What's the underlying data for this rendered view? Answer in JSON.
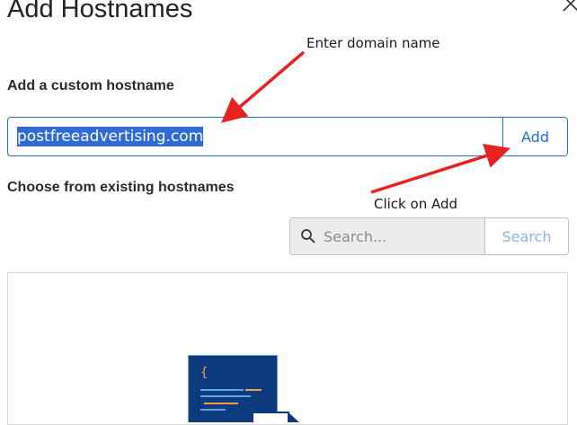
{
  "dialog": {
    "title": "Add Hostnames"
  },
  "custom_hostname": {
    "label": "Add a custom hostname",
    "value": "postfreeadvertising.com",
    "add_label": "Add"
  },
  "existing": {
    "label": "Choose from existing hostnames",
    "search_placeholder": "Search...",
    "search_label": "Search"
  },
  "annotations": {
    "enter_domain": "Enter domain name",
    "click_add": "Click on Add"
  },
  "colors": {
    "accent": "#1e6fd9",
    "selection": "#2f6bd8",
    "annotation_arrow": "#e8231f"
  },
  "icons": [
    "close-icon",
    "search-icon",
    "code-file-illustration"
  ]
}
